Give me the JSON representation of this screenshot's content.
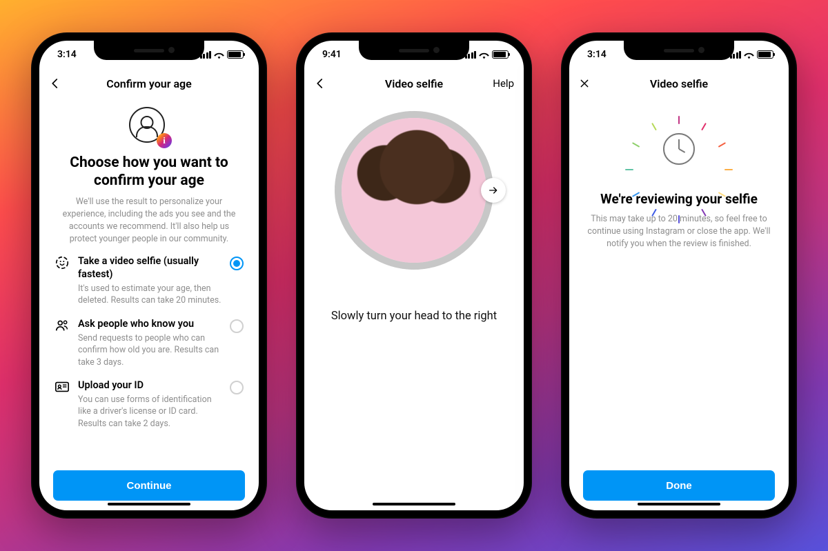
{
  "screen1": {
    "status_time": "3:14",
    "nav_title": "Confirm your age",
    "title": "Choose how you want to confirm your age",
    "subtitle": "We'll use the result to personalize your experience, including the ads you see and the accounts we recommend. It'll also help us protect younger people in our community.",
    "options": [
      {
        "title": "Take a video selfie (usually fastest)",
        "desc": "It's used to estimate your age, then deleted. Results can take 20 minutes.",
        "selected": true
      },
      {
        "title": "Ask people who know you",
        "desc": "Send requests to people who can confirm how old you are. Results can take 3 days.",
        "selected": false
      },
      {
        "title": "Upload your ID",
        "desc": "You can use forms of identification like a driver's license or ID card. Results can take 2 days.",
        "selected": false
      }
    ],
    "cta": "Continue"
  },
  "screen2": {
    "status_time": "9:41",
    "nav_title": "Video selfie",
    "nav_right": "Help",
    "instruction": "Slowly turn your head to the right"
  },
  "screen3": {
    "status_time": "3:14",
    "nav_title": "Video selfie",
    "title": "We're reviewing your selfie",
    "subtitle": "This may take up to 20 minutes, so feel free to continue using Instagram or close the app. We'll notify you when the review is finished.",
    "cta": "Done"
  }
}
